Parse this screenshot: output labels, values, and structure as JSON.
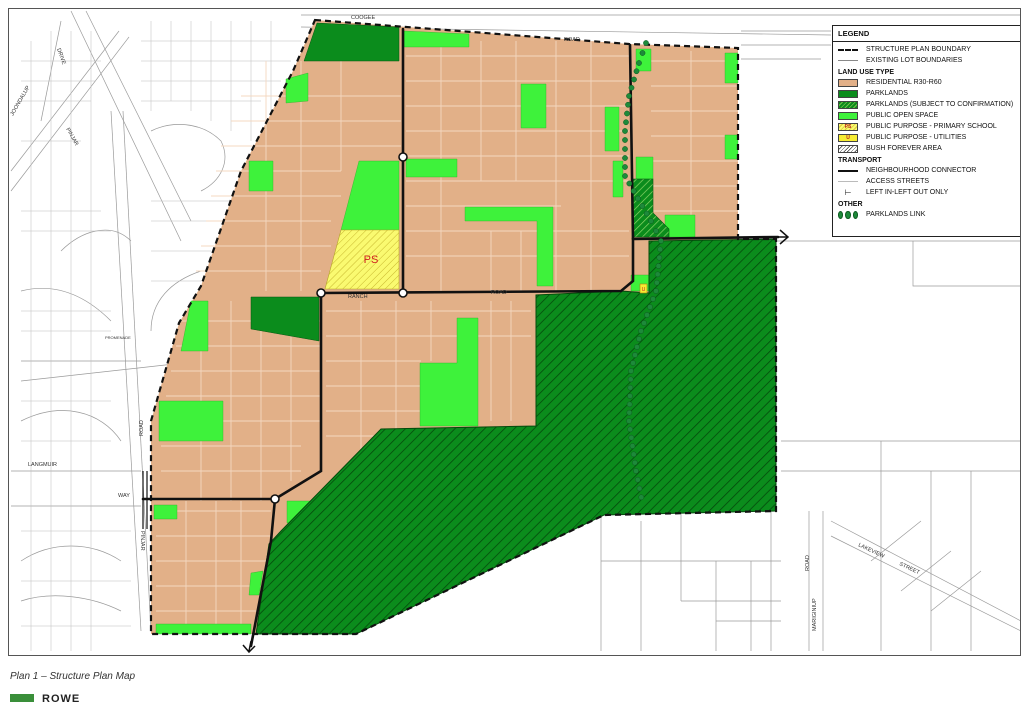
{
  "legend": {
    "title": "LEGEND",
    "items": [
      {
        "label": "STRUCTURE PLAN BOUNDARY"
      },
      {
        "label": "EXISTING LOT BOUNDARIES"
      }
    ],
    "land_use_heading": "LAND USE TYPE",
    "land_use": [
      {
        "label": "RESIDENTIAL R30-R60"
      },
      {
        "label": "PARKLANDS"
      },
      {
        "label": "PARKLANDS (SUBJECT TO CONFIRMATION)"
      },
      {
        "label": "PUBLIC OPEN SPACE"
      },
      {
        "label": "PUBLIC PURPOSE - PRIMARY SCHOOL",
        "code": "PS"
      },
      {
        "label": "PUBLIC PURPOSE - UTILITIES",
        "code": "U"
      },
      {
        "label": "BUSH FOREVER AREA"
      }
    ],
    "transport_heading": "TRANSPORT",
    "transport": [
      {
        "label": "NEIGHBOURHOOD CONNECTOR"
      },
      {
        "label": "ACCESS STREETS"
      },
      {
        "label": "LEFT IN-LEFT OUT ONLY"
      }
    ],
    "other_heading": "OTHER",
    "other": [
      {
        "label": "PARKLANDS LINK"
      }
    ]
  },
  "map": {
    "school_label": "PS",
    "utility_label": "U",
    "roads": {
      "coogee": "COOGEE",
      "coogee_road": "ROAD",
      "ranch": "RANCH",
      "ranch_road": "ROAD",
      "langmuir": "LANGMUIR",
      "langmuir_way": "WAY",
      "pinjar_north": "PINJAR",
      "pinjar_south": "PINJAR",
      "pinjar_road": "ROAD",
      "lakeview": "LAKEVIEW",
      "lakeview_street": "STREET",
      "mariginiup": "MARIGINIUP",
      "mariginiup_road": "ROAD",
      "drive": "DRIVE",
      "joondalup": "JOONDALUP",
      "promenade": "PROMENADE"
    },
    "colors": {
      "residential": "#e2b088",
      "parklands": "#0b8c1c",
      "public_open_space": "#3ef23b",
      "school": "#fafa70",
      "boundary": "#111111",
      "existing_lots": "#9a9a9a"
    }
  },
  "caption": "Plan 1 – Structure Plan Map",
  "footer": {
    "brand": "ROWE"
  }
}
